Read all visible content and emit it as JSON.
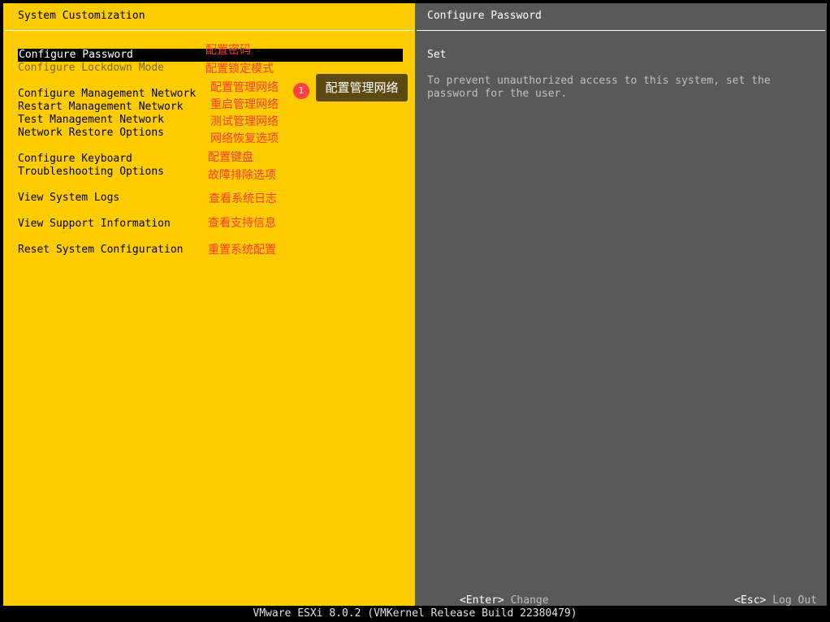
{
  "left_pane": {
    "title": "System Customization",
    "menu": [
      {
        "label": "Configure Password",
        "annotation": "配置密码"
      },
      {
        "label": "Configure Lockdown Mode",
        "annotation": "配置锁定模式"
      },
      {
        "label": "Configure Management Network",
        "annotation": "配置管理网络"
      },
      {
        "label": "Restart Management Network",
        "annotation": "重启管理网络"
      },
      {
        "label": "Test Management Network",
        "annotation": "测试管理网络"
      },
      {
        "label": "Network Restore Options",
        "annotation": "网络恢复选项"
      },
      {
        "label": "Configure Keyboard",
        "annotation": "配置键盘"
      },
      {
        "label": "Troubleshooting Options",
        "annotation": "故障排除选项"
      },
      {
        "label": "View System Logs",
        "annotation": "查看系统日志"
      },
      {
        "label": "View Support Information",
        "annotation": "查看支持信息"
      },
      {
        "label": "Reset System Configuration",
        "annotation": "重置系统配置"
      }
    ],
    "callout": {
      "badge": "1",
      "text": "配置管理网络"
    }
  },
  "right_pane": {
    "title": "Configure Password",
    "heading": "Set",
    "description": "To prevent unauthorized access to this system, set the\npassword for the user.",
    "footer_left": {
      "key": "<Enter>",
      "action": "Change"
    },
    "footer_right": {
      "key": "<Esc>",
      "action": "Log Out"
    }
  },
  "status_bar": "VMware ESXi 8.0.2 (VMKernel Release Build 22380479)",
  "colors": {
    "left_bg": "#ffcc00",
    "right_bg": "#595959",
    "annotation": "#ff3b2f",
    "callout_badge": "#ff4040"
  }
}
